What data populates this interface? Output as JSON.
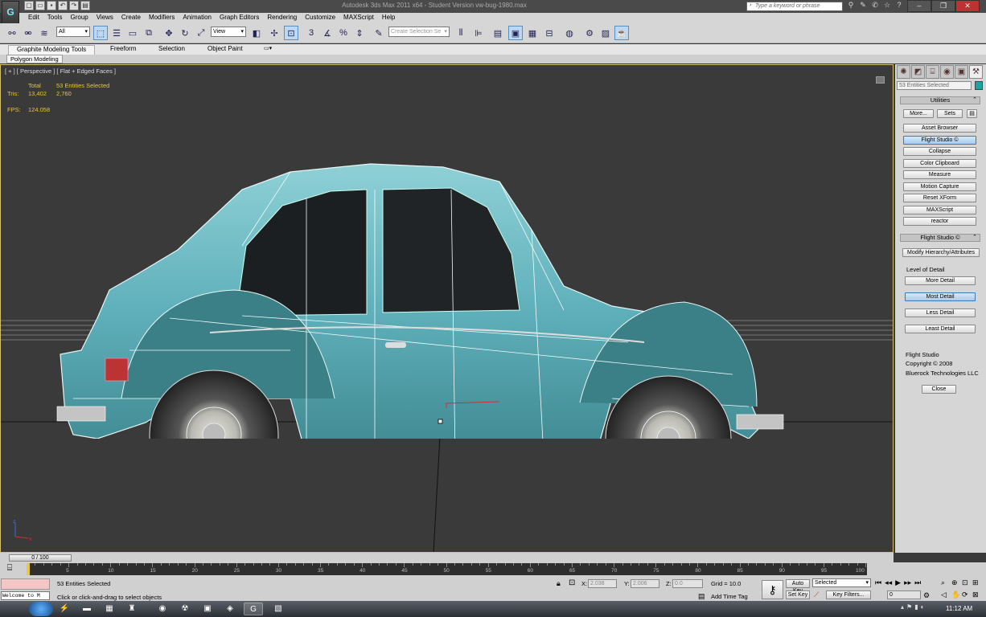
{
  "window": {
    "title": "Autodesk 3ds Max 2011 x64  -  Student Version   vw-bug-1980.max",
    "logo_letter": "G",
    "search_placeholder": "Type a keyword or phrase",
    "controls": [
      "–",
      "❐",
      "✕"
    ]
  },
  "menu": [
    "Edit",
    "Tools",
    "Group",
    "Views",
    "Create",
    "Modifiers",
    "Animation",
    "Graph Editors",
    "Rendering",
    "Customize",
    "MAXScript",
    "Help"
  ],
  "toolbar": {
    "filter_value": "All",
    "refcoord_value": "View",
    "named_selection_placeholder": "Create Selection Se"
  },
  "ribbon": {
    "tabs": [
      "Graphite Modeling Tools",
      "Freeform",
      "Selection",
      "Object Paint"
    ],
    "subtab": "Polygon Modeling"
  },
  "viewport": {
    "label": "[ + ] [ Perspective ] [ Flat + Edged Faces ]",
    "stats": {
      "header_total": "Total",
      "header_selected": "53 Entities Selected",
      "tris_label": "Tris:",
      "tris_total": "13,402",
      "tris_selected": "2,760",
      "fps_label": "FPS:",
      "fps_value": "124.058"
    },
    "axis_x": "x",
    "axis_z": "z"
  },
  "command_panel": {
    "selection_text": "53 Entities Selected",
    "object_color": "#17a6a6",
    "utilities_header": "Utilities",
    "more_label": "More...",
    "sets_label": "Sets",
    "utility_buttons": [
      "Asset Browser",
      "Flight Studio ©",
      "Collapse",
      "Color Clipboard",
      "Measure",
      "Motion Capture",
      "Reset XForm",
      "MAXScript",
      "reactor"
    ],
    "active_utility": "Flight Studio ©",
    "flight_header": "Flight Studio ©",
    "modify_hierarchy_label": "Modify Hierarchy/Attributes",
    "lod_label": "Level of Detail",
    "lod_buttons": [
      "More Detail",
      "Most Detail",
      "Less Detail",
      "Least Detail"
    ],
    "active_lod": "Most Detail",
    "about_lines": [
      "Flight Studio",
      "Copyright © 2008",
      "Bluerock Technologies LLC"
    ],
    "close_label": "Close"
  },
  "time": {
    "slider_label": "0 / 100",
    "current_frame": 0,
    "total_frames": 100,
    "ticks": [
      "0",
      "5",
      "10",
      "15",
      "20",
      "25",
      "30",
      "35",
      "40",
      "45",
      "50",
      "55",
      "60",
      "65",
      "70",
      "75",
      "80",
      "85",
      "90",
      "95",
      "100"
    ]
  },
  "status": {
    "welcome": "Welcome to M",
    "selection": "53 Entities Selected",
    "prompt": "Click or click-and-drag to select objects",
    "x_label": "X:",
    "x_value": "2.038",
    "y_label": "Y:",
    "y_value": "2.006",
    "z_label": "Z:",
    "z_value": "0.0",
    "grid": "Grid = 10.0",
    "add_time_tag": "Add Time Tag",
    "auto_key": "Auto Key",
    "set_key": "Set Key",
    "selected_option": "Selected",
    "key_filters": "Key Filters...",
    "frame_value": "0"
  },
  "taskbar": {
    "clock": "11:12 AM"
  }
}
